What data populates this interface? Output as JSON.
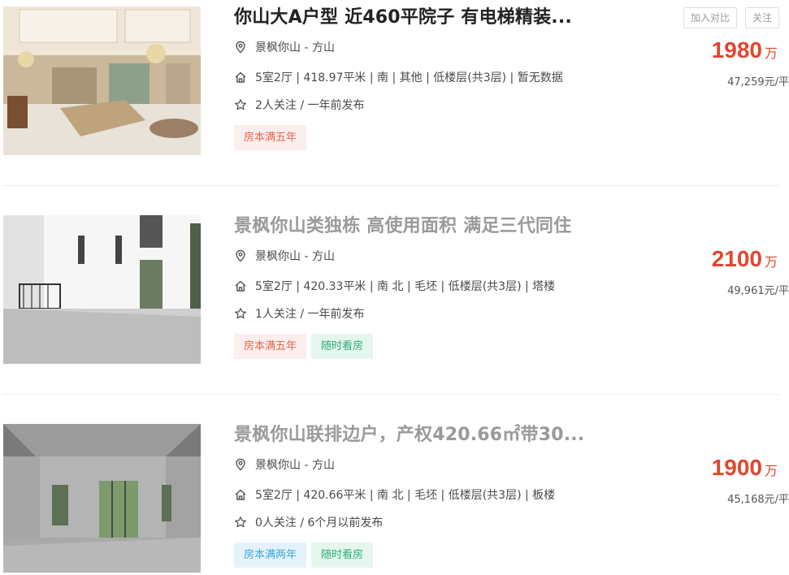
{
  "buttons": {
    "compare": "加入对比",
    "follow": "关注"
  },
  "listings": [
    {
      "title": "你山大A户型 近460平院子 有电梯精装...",
      "location": "景枫你山 - 方山",
      "info": "5室2厅 | 418.97平米 | 南 | 其他 | 低楼层(共3层) | 暂无数据",
      "follow": "2人关注 / 一年前发布",
      "tags": [
        "房本满五年"
      ],
      "price": "1980",
      "price_unit": "万",
      "unit_price": "47,259元/平"
    },
    {
      "title": "景枫你山类独栋 高使用面积 满足三代同住",
      "location": "景枫你山 - 方山",
      "info": "5室2厅 | 420.33平米 | 南 北 | 毛坯 | 低楼层(共3层) | 塔楼",
      "follow": "1人关注 / 一年前发布",
      "tags": [
        "房本满五年",
        "随时看房"
      ],
      "price": "2100",
      "price_unit": "万",
      "unit_price": "49,961元/平"
    },
    {
      "title": "景枫你山联排边户，产权420.66㎡带30...",
      "location": "景枫你山 - 方山",
      "info": "5室2厅 | 420.66平米 | 南 北 | 毛坯 | 低楼层(共3层) | 板楼",
      "follow": "0人关注 / 6个月以前发布",
      "tags": [
        "房本满两年",
        "随时看房"
      ],
      "price": "1900",
      "price_unit": "万",
      "unit_price": "45,168元/平"
    }
  ],
  "icons": {
    "location": "location-pin-icon",
    "house": "house-icon",
    "star": "star-icon"
  }
}
